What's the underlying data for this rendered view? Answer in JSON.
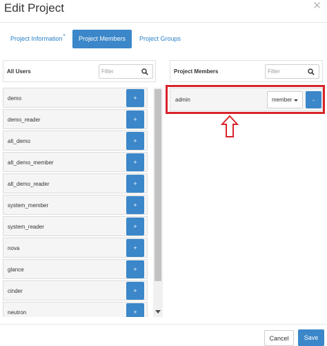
{
  "dialog": {
    "title": "Edit Project",
    "close_icon": "close-icon"
  },
  "tabs": [
    {
      "label": "Project Information",
      "required_marker": "*"
    },
    {
      "label": "Project Members",
      "active": true
    },
    {
      "label": "Project Groups"
    }
  ],
  "all_users": {
    "header": "All Users",
    "filter_placeholder": "Filter",
    "add_label": "+",
    "users": [
      "demo",
      "demo_reader",
      "alt_demo",
      "alt_demo_member",
      "alt_demo_reader",
      "system_member",
      "system_reader",
      "nova",
      "glance",
      "cinder",
      "neutron"
    ]
  },
  "project_members": {
    "header": "Project Members",
    "filter_placeholder": "Filter",
    "members": [
      {
        "name": "admin",
        "role": "member",
        "remove_label": "-"
      }
    ]
  },
  "footer": {
    "cancel_label": "Cancel",
    "save_label": "Save"
  },
  "colors": {
    "primary": "#3b87c9",
    "link": "#2a80c6",
    "highlight": "#d8232a"
  }
}
